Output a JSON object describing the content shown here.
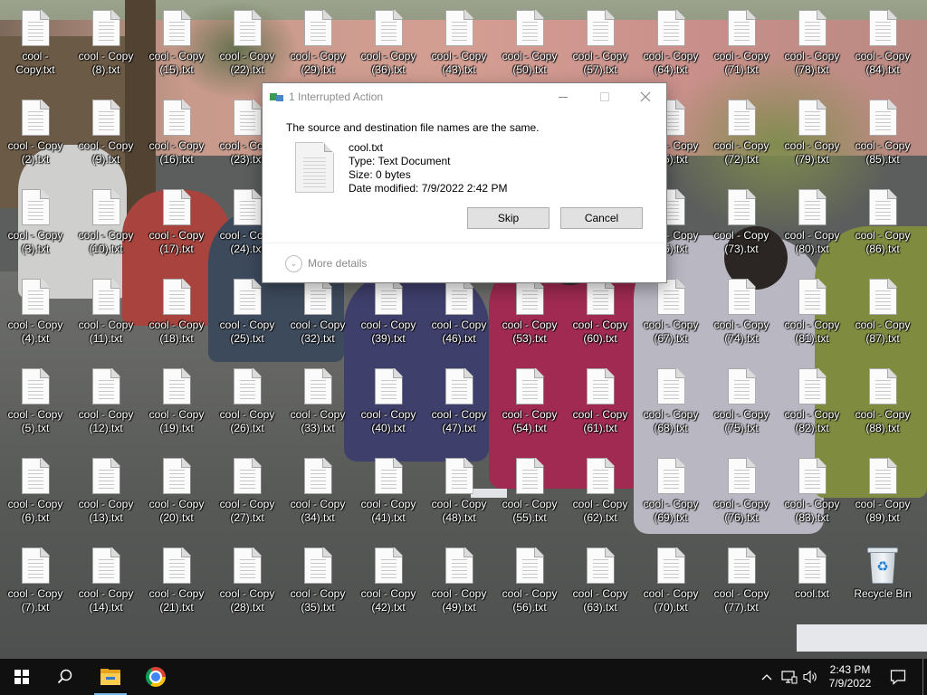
{
  "desktop": {
    "icons": [
      [
        "cool -\nCopy.txt",
        "cool - Copy\n(2).txt",
        "cool - Copy\n(3).txt",
        "cool - Copy\n(4).txt",
        "cool - Copy\n(5).txt",
        "cool - Copy\n(6).txt",
        "cool - Copy\n(7).txt"
      ],
      [
        "cool - Copy\n(8).txt",
        "cool - Copy\n(9).txt",
        "cool - Copy\n(10).txt",
        "cool - Copy\n(11).txt",
        "cool - Copy\n(12).txt",
        "cool - Copy\n(13).txt",
        "cool - Copy\n(14).txt"
      ],
      [
        "cool - Copy\n(15).txt",
        "cool - Copy\n(16).txt",
        "cool - Copy\n(17).txt",
        "cool - Copy\n(18).txt",
        "cool - Copy\n(19).txt",
        "cool - Copy\n(20).txt",
        "cool - Copy\n(21).txt"
      ],
      [
        "cool - Copy\n(22).txt",
        "cool - Copy\n(23).txt",
        "cool - Copy\n(24).txt",
        "cool - Copy\n(25).txt",
        "cool - Copy\n(26).txt",
        "cool - Copy\n(27).txt",
        "cool - Copy\n(28).txt"
      ],
      [
        "cool - Copy\n(29).txt",
        "",
        "",
        "cool - Copy\n(32).txt",
        "cool - Copy\n(33).txt",
        "cool - Copy\n(34).txt",
        "cool - Copy\n(35).txt"
      ],
      [
        "cool - Copy\n(36).txt",
        "",
        "",
        "cool - Copy\n(39).txt",
        "cool - Copy\n(40).txt",
        "cool - Copy\n(41).txt",
        "cool - Copy\n(42).txt"
      ],
      [
        "cool - Copy\n(43).txt",
        "",
        "",
        "cool - Copy\n(46).txt",
        "cool - Copy\n(47).txt",
        "cool - Copy\n(48).txt",
        "cool - Copy\n(49).txt"
      ],
      [
        "cool - Copy\n(50).txt",
        "",
        "",
        "cool - Copy\n(53).txt",
        "cool - Copy\n(54).txt",
        "cool - Copy\n(55).txt",
        "cool - Copy\n(56).txt"
      ],
      [
        "cool - Copy\n(57).txt",
        "",
        "",
        "cool - Copy\n(60).txt",
        "cool - Copy\n(61).txt",
        "cool - Copy\n(62).txt",
        "cool - Copy\n(63).txt"
      ],
      [
        "cool - Copy\n(64).txt",
        "cool - Copy\n(65).txt",
        "cool - Copy\n(66).txt",
        "cool - Copy\n(67).txt",
        "cool - Copy\n(68).txt",
        "cool - Copy\n(69).txt",
        "cool - Copy\n(70).txt"
      ],
      [
        "cool - Copy\n(71).txt",
        "cool - Copy\n(72).txt",
        "cool - Copy\n(73).txt",
        "cool - Copy\n(74).txt",
        "cool - Copy\n(75).txt",
        "cool - Copy\n(76).txt",
        "cool - Copy\n(77).txt"
      ],
      [
        "cool - Copy\n(78).txt",
        "cool - Copy\n(79).txt",
        "cool - Copy\n(80).txt",
        "cool - Copy\n(81).txt",
        "cool - Copy\n(82).txt",
        "cool - Copy\n(83).txt",
        "cool.txt"
      ],
      [
        "cool - Copy\n(84).txt",
        "cool - Copy\n(85).txt",
        "cool - Copy\n(86).txt",
        "cool - Copy\n(87).txt",
        "cool - Copy\n(88).txt",
        "cool - Copy\n(89).txt",
        "Recycle Bin"
      ]
    ]
  },
  "dialog": {
    "title": "1 Interrupted Action",
    "message": "The source and destination file names are the same.",
    "file_name": "cool.txt",
    "file_type": "Type: Text Document",
    "file_size": "Size: 0 bytes",
    "date_modified": "Date modified: 7/9/2022 2:42 PM",
    "skip_label": "Skip",
    "cancel_label": "Cancel",
    "more_details_label": "More details"
  },
  "taskbar": {
    "apps": [
      {
        "name": "start",
        "icon": "windows-logo-icon"
      },
      {
        "name": "search",
        "icon": "search-icon"
      },
      {
        "name": "file-explorer",
        "icon": "folder-icon",
        "active": true
      },
      {
        "name": "chrome",
        "icon": "chrome-icon"
      }
    ],
    "tray_chevron": "^",
    "time": "2:43 PM",
    "date": "7/9/2022"
  },
  "colors": {
    "taskbar_bg": "#101010",
    "active_indicator": "#76b9ed",
    "dialog_button_bg": "#e1e1e1"
  }
}
